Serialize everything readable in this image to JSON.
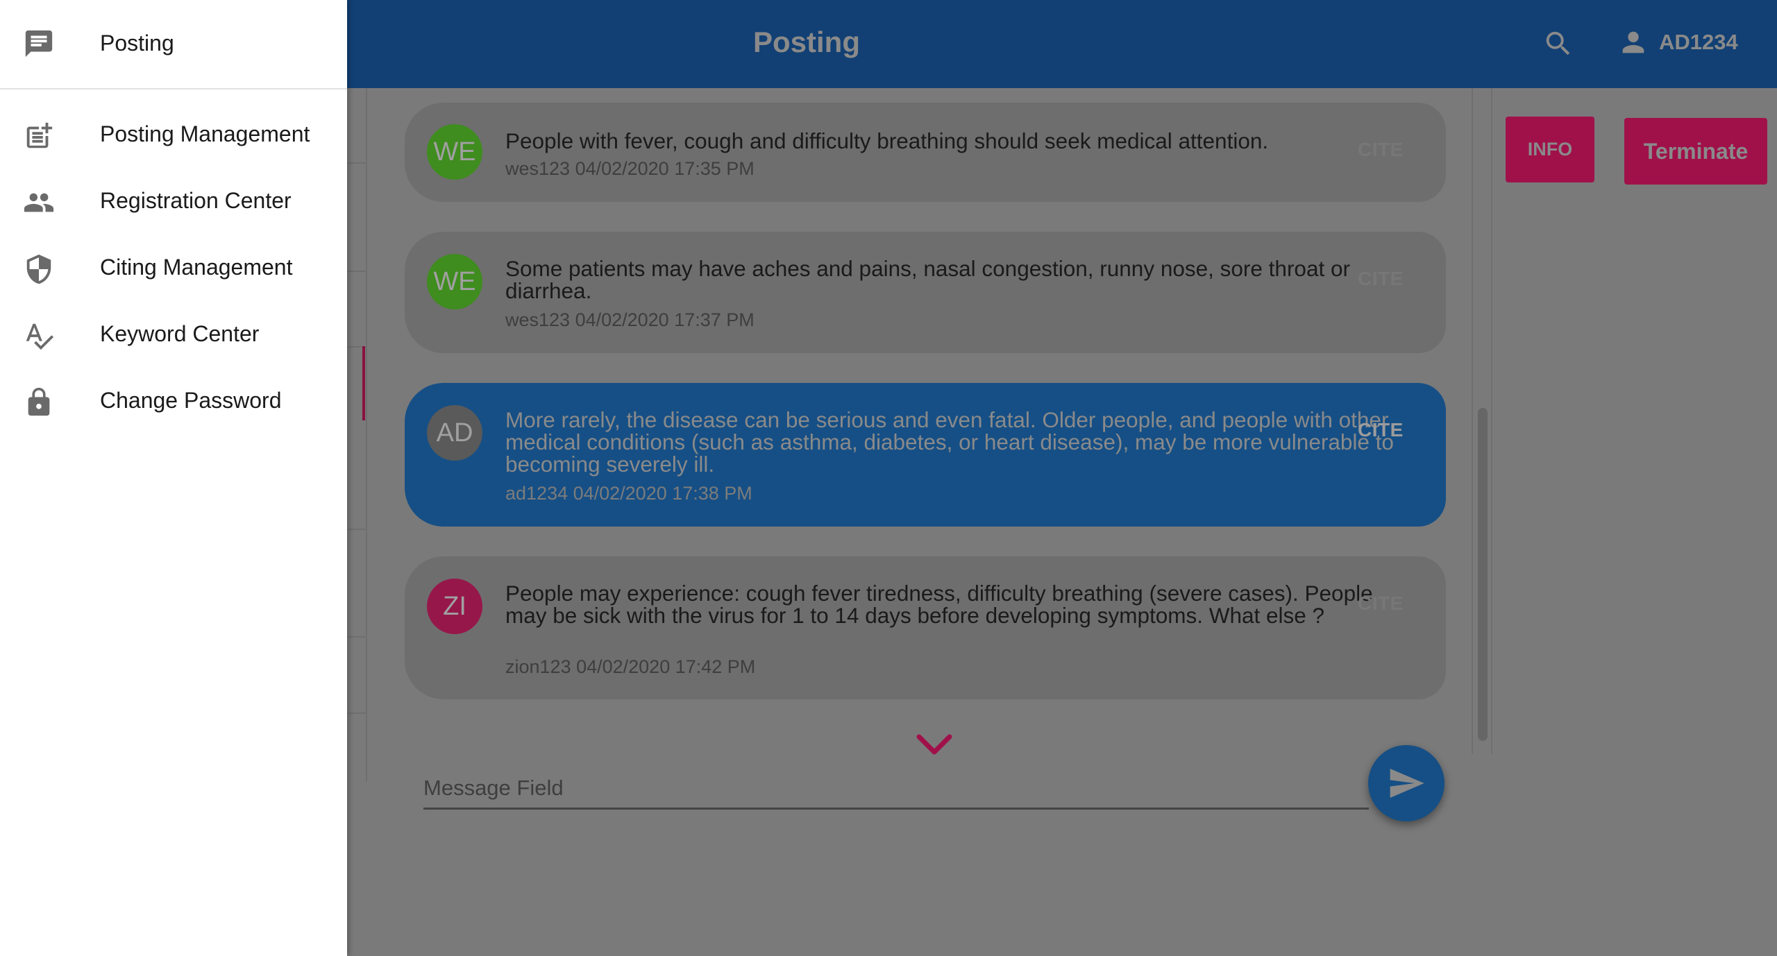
{
  "app_bar": {
    "title": "Posting",
    "user": "AD1234"
  },
  "drawer": {
    "header": {
      "icon": "chat-icon",
      "label": "Posting"
    },
    "items": [
      {
        "icon": "post-add-icon",
        "label": "Posting Management"
      },
      {
        "icon": "people-icon",
        "label": "Registration Center"
      },
      {
        "icon": "shield-icon",
        "label": "Citing Management"
      },
      {
        "icon": "spellcheck-icon",
        "label": "Keyword Center"
      },
      {
        "icon": "lock-icon",
        "label": "Change Password"
      }
    ]
  },
  "messages": [
    {
      "initials": "WE",
      "text": "People with fever, cough and difficulty breathing should seek medical attention.",
      "meta": "wes123 04/02/2020 17:35 PM",
      "cite": "CITE",
      "avatar_color": "#3f8c1f"
    },
    {
      "initials": "WE",
      "text": "Some patients may have aches and pains, nasal congestion, runny nose, sore throat or diarrhea.",
      "meta": "wes123 04/02/2020 17:37 PM",
      "cite": "CITE",
      "avatar_color": "#3f8c1f"
    },
    {
      "initials": "AD",
      "text": "More rarely, the disease can be serious and even fatal. Older people, and people with other medical conditions (such as asthma, diabetes, or heart disease), may be more vulnerable to becoming severely ill.",
      "meta": "ad1234 04/02/2020 17:38 PM",
      "cite": "CITE",
      "avatar_color": "#5a5a5a"
    },
    {
      "initials": "ZI",
      "text": "People may experience: cough fever tiredness, difficulty breathing (severe cases). People may be sick with the virus for 1 to 14 days before developing symptoms. What else ?",
      "meta": "zion123 04/02/2020 17:42 PM",
      "cite": "CITE",
      "avatar_color": "#96174a"
    }
  ],
  "composer": {
    "placeholder": "Message Field"
  },
  "actions": {
    "info": "INFO",
    "terminate": "Terminate"
  },
  "colors": {
    "app_bar": "#124074",
    "accent": "#a0114a",
    "own_message": "#164f85"
  }
}
